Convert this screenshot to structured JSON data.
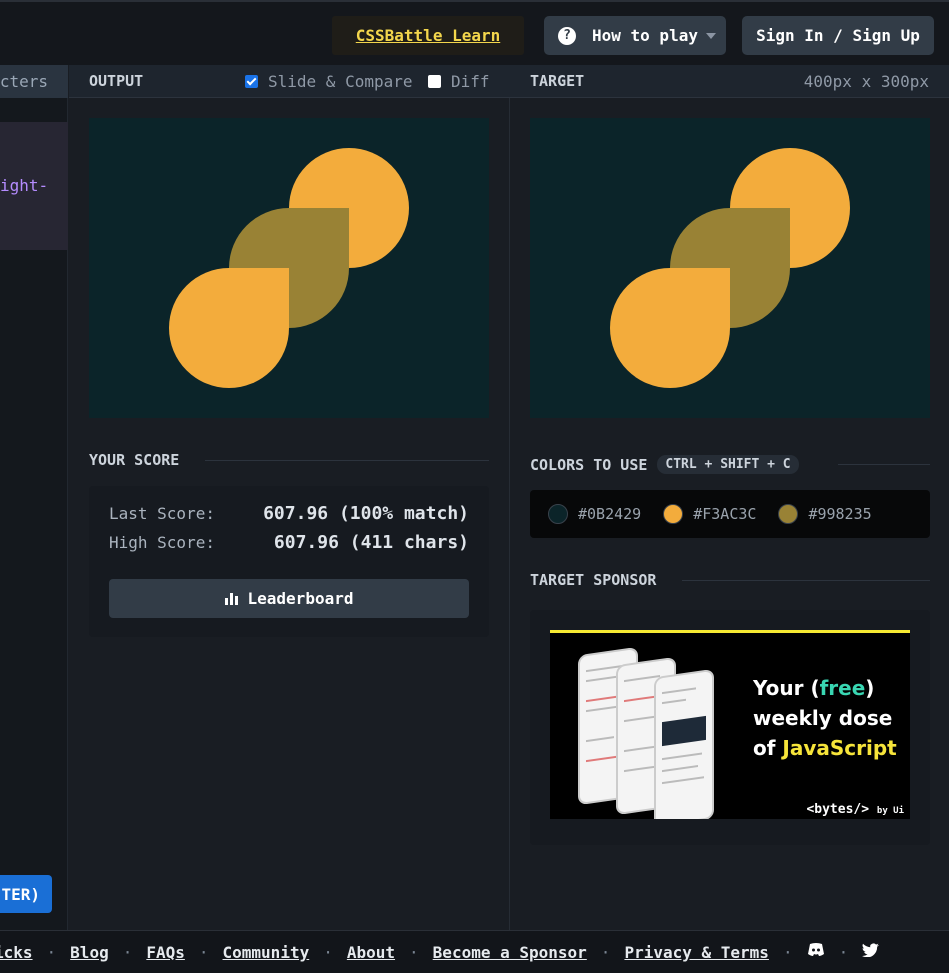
{
  "header": {
    "learn_link": "CSSBattle Learn",
    "howto_label": "How to play",
    "howto_icon": "question-circle-icon",
    "signin_label": "Sign In / Sign Up"
  },
  "left_pane": {
    "header_partial": "cters",
    "code_partial": "ight-",
    "submit_partial": "TER)"
  },
  "output": {
    "title": "OUTPUT",
    "slide_compare_label": "Slide & Compare",
    "slide_compare_checked": true,
    "diff_label": "Diff",
    "diff_checked": false
  },
  "target": {
    "title": "TARGET",
    "dimensions": "400px x 300px"
  },
  "score": {
    "title": "YOUR SCORE",
    "last_label": "Last Score:",
    "last_value": "607.96 (100% match)",
    "high_label": "High Score:",
    "high_value": "607.96 (411 chars)",
    "leaderboard_label": "Leaderboard"
  },
  "colors_section": {
    "title": "COLORS TO USE",
    "shortcut": "CTRL + SHIFT + C",
    "colors": [
      {
        "hex": "#0B2429",
        "value": "#0b2429"
      },
      {
        "hex": "#F3AC3C",
        "value": "#f3ac3c"
      },
      {
        "hex": "#998235",
        "value": "#998235"
      }
    ]
  },
  "sponsor": {
    "title": "TARGET SPONSOR",
    "ad_line1_a": "Your (",
    "ad_line1_free": "free",
    "ad_line1_b": ")",
    "ad_line2": "weekly dose",
    "ad_line3_a": "of ",
    "ad_line3_js": "JavaScript",
    "ad_logo": "<bytes/>",
    "ad_logo_by": "by Ui"
  },
  "footer": {
    "links": [
      "icks",
      "Blog",
      "FAQs",
      "Community",
      "About",
      "Become a Sponsor",
      "Privacy & Terms"
    ],
    "icons": [
      "discord-icon",
      "twitter-icon"
    ]
  }
}
